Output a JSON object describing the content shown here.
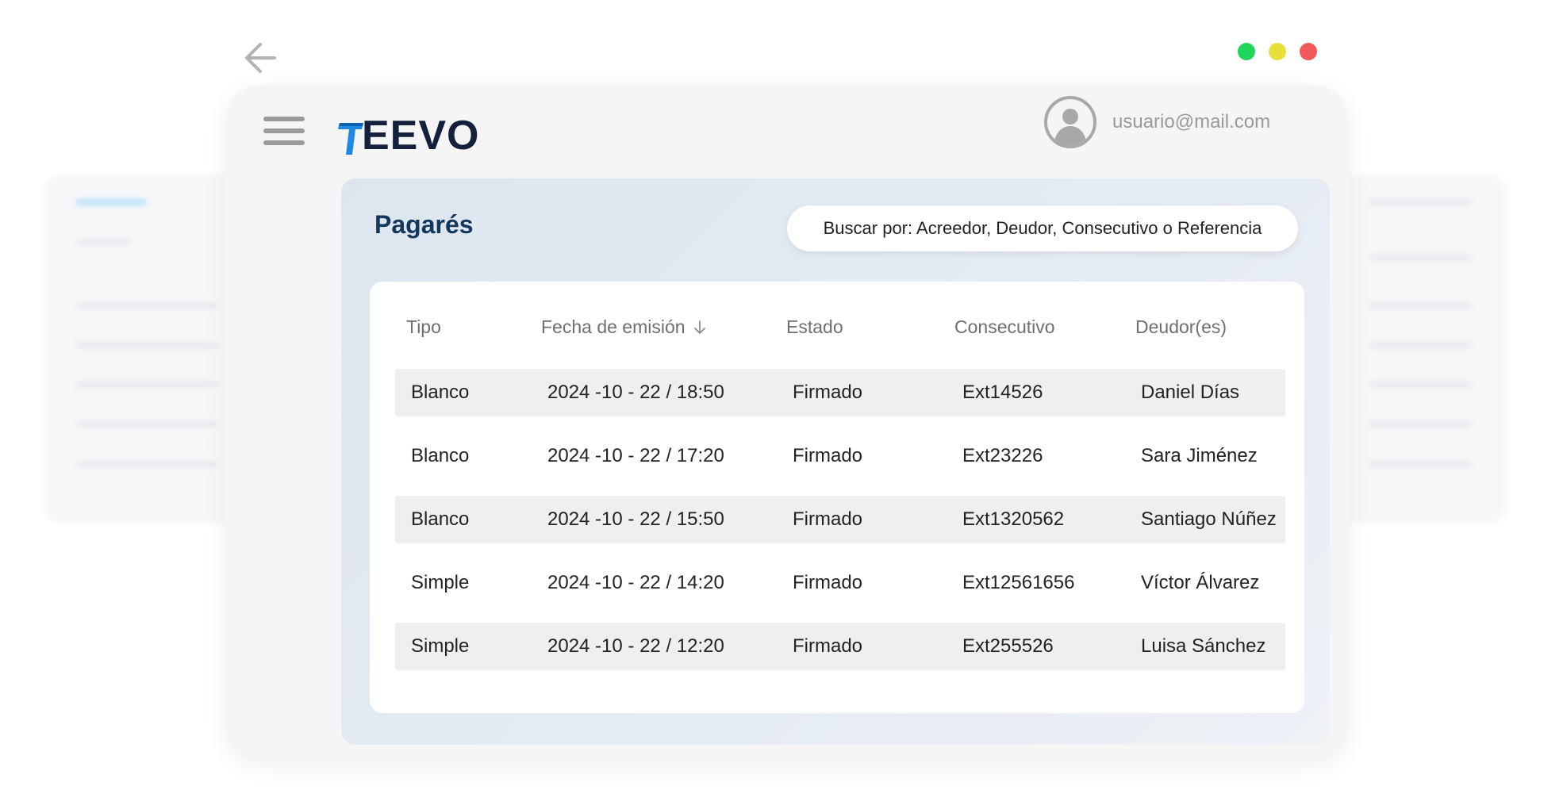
{
  "colors": {
    "dot_green": "#1ed65a",
    "dot_yellow": "#e7e03a",
    "dot_red": "#f25a5a",
    "logo_blue": "#1e88e5",
    "logo_dark": "#14213d",
    "title_blue": "#14375e"
  },
  "icons": [
    "back-arrow-icon",
    "hamburger-menu-icon",
    "user-avatar-icon",
    "sort-down-arrow-icon"
  ],
  "header": {
    "logo_text": "EEVO",
    "user_email": "usuario@mail.com"
  },
  "main": {
    "title": "Pagarés",
    "search_placeholder": "Buscar por: Acreedor, Deudor, Consecutivo o Referencia",
    "table": {
      "columns": [
        "Tipo",
        "Fecha de emisión",
        "Estado",
        "Consecutivo",
        "Deudor(es)"
      ],
      "rows": [
        {
          "tipo": "Blanco",
          "fecha": "2024 -10 - 22 / 18:50",
          "estado": "Firmado",
          "consecutivo": "Ext14526",
          "deudor": "Daniel Días"
        },
        {
          "tipo": "Blanco",
          "fecha": "2024 -10 - 22  / 17:20",
          "estado": "Firmado",
          "consecutivo": "Ext23226",
          "deudor": "Sara Jiménez"
        },
        {
          "tipo": "Blanco",
          "fecha": "2024 -10 - 22  / 15:50",
          "estado": "Firmado",
          "consecutivo": "Ext1320562",
          "deudor": "Santiago Núñez"
        },
        {
          "tipo": "Simple",
          "fecha": "2024 -10 - 22  / 14:20",
          "estado": "Firmado",
          "consecutivo": "Ext12561656",
          "deudor": "Víctor Álvarez"
        },
        {
          "tipo": "Simple",
          "fecha": "2024 -10 - 22  / 12:20",
          "estado": "Firmado",
          "consecutivo": "Ext255526",
          "deudor": "Luisa Sánchez"
        }
      ]
    }
  }
}
